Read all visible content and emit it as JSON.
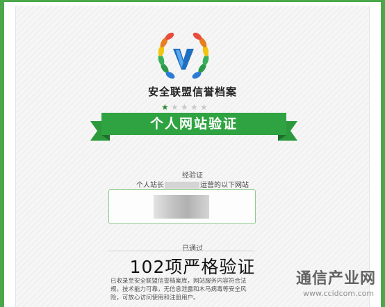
{
  "brand": {
    "title": "安全联盟信誉档案",
    "stars": [
      true,
      false,
      false,
      false,
      false
    ]
  },
  "ribbon": {
    "text": "个人网站验证"
  },
  "verify": {
    "label": "经验证",
    "owner_prefix": "个人站长",
    "owner_suffix": "运营的以下网站"
  },
  "passed": {
    "label": "已通过",
    "title": "102项严格验证",
    "desc": "已收录至安全联盟信誉档案库，网站服务内容符合法规，技术能力可靠，无信息泄露和木马病毒等安全风险，可放心访问使用和注册用户。"
  },
  "watermark": {
    "cn": "通信产业网",
    "url": "www.ccidcom.com"
  },
  "colors": {
    "frame": "#4aa84a",
    "ribbon": "#2c9a3c",
    "ribbon_dark": "#1d6e2a",
    "accent": "#2d8a2d"
  }
}
